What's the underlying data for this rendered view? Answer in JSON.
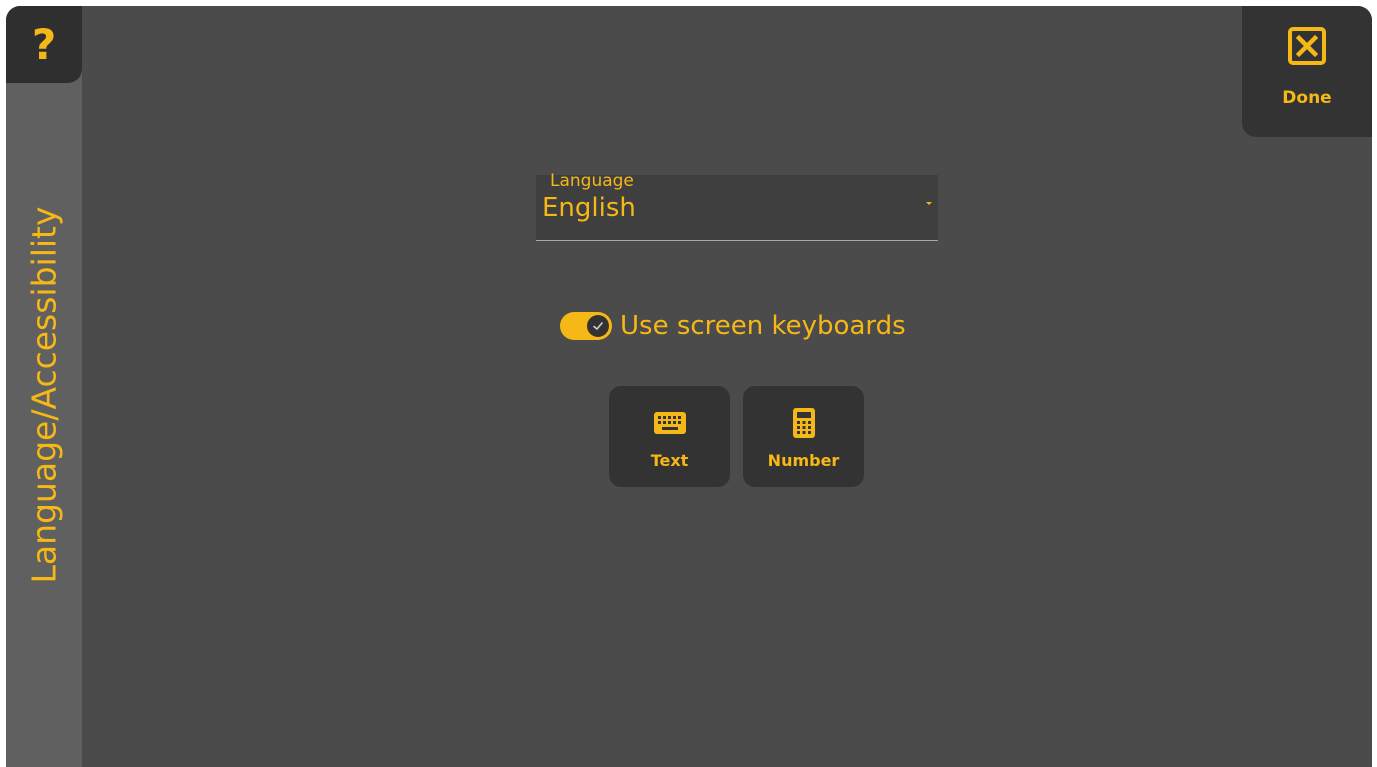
{
  "colors": {
    "accent": "#f6b816",
    "panel_bg": "#4b4b4b",
    "rail_bg": "#606060",
    "button_bg": "#333333"
  },
  "help": {
    "label": "?",
    "icon": "help-icon"
  },
  "sidebar": {
    "title": "Language/Accessibility"
  },
  "done": {
    "label": "Done",
    "icon": "close-box-icon"
  },
  "language": {
    "label": "Language",
    "value": "English"
  },
  "screen_keyboards": {
    "label": "Use screen keyboards",
    "enabled": true
  },
  "keyboard_buttons": [
    {
      "label": "Text",
      "icon": "keyboard-icon"
    },
    {
      "label": "Number",
      "icon": "calculator-icon"
    }
  ]
}
